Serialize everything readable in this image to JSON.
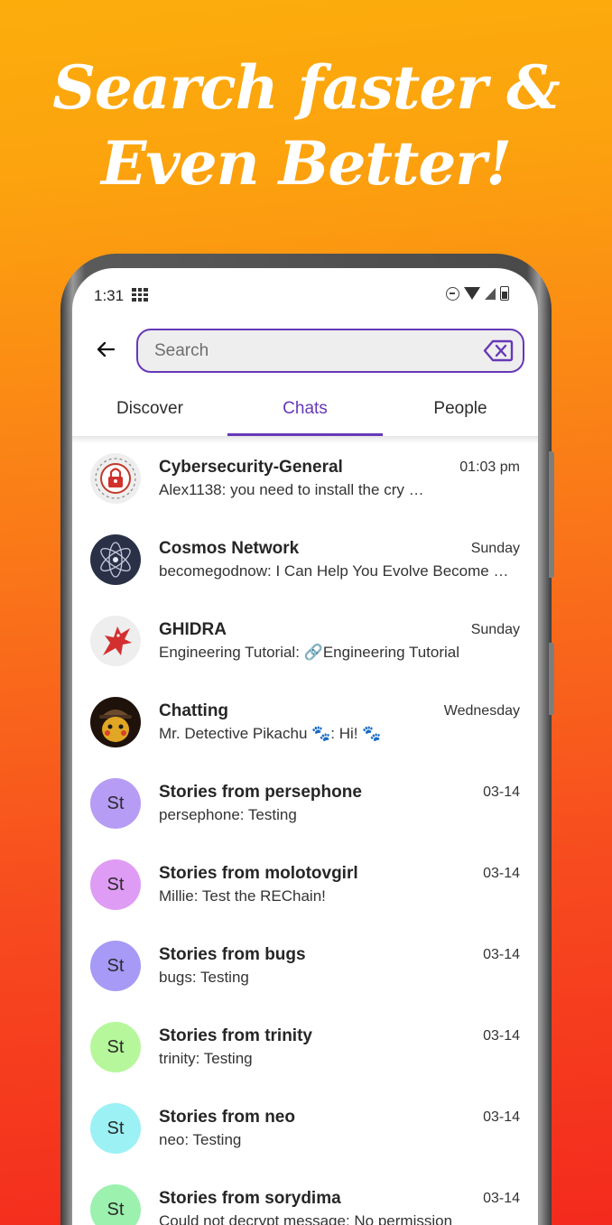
{
  "headline": {
    "line1": "Search faster &",
    "line2": "Even Better!"
  },
  "status_bar": {
    "time": "1:31",
    "icons": [
      "grid-icon",
      "dnd-icon",
      "wifi-icon",
      "signal-icon",
      "battery-icon"
    ]
  },
  "search": {
    "value": "",
    "placeholder": "Search"
  },
  "tabs": [
    {
      "label": "Discover",
      "active": false
    },
    {
      "label": "Chats",
      "active": true
    },
    {
      "label": "People",
      "active": false
    }
  ],
  "colors": {
    "accent": "#6638b8",
    "search_bg": "#eeeeee"
  },
  "chats": [
    {
      "name": "Cybersecurity-General",
      "time": "01:03 pm",
      "preview": "Alex1138: you need to install the cry …",
      "avatar": {
        "type": "image",
        "icon": "padlock-circuit-icon"
      }
    },
    {
      "name": "Cosmos Network",
      "time": "Sunday",
      "preview": "becomegodnow: I Can Help You Evolve Become …",
      "avatar": {
        "type": "image",
        "icon": "atom-icon"
      }
    },
    {
      "name": "GHIDRA",
      "time": "Sunday",
      "preview": "Engineering Tutorial: 🔗Engineering Tutorial",
      "avatar": {
        "type": "image",
        "icon": "dragon-icon"
      }
    },
    {
      "name": "Chatting",
      "time": "Wednesday",
      "preview": "Mr. Detective Pikachu 🐾: Hi! 🐾",
      "avatar": {
        "type": "image",
        "icon": "detective-pikachu-icon"
      }
    },
    {
      "name": "Stories from persephone",
      "time": "03-14",
      "preview": "persephone: Testing",
      "avatar": {
        "type": "initials",
        "initials": "St",
        "color": "#b69cf4"
      }
    },
    {
      "name": "Stories from molotovgirl",
      "time": "03-14",
      "preview": "Millie: Test the REChain!",
      "avatar": {
        "type": "initials",
        "initials": "St",
        "color": "#df9cf4"
      }
    },
    {
      "name": "Stories from bugs",
      "time": "03-14",
      "preview": "bugs: Testing",
      "avatar": {
        "type": "initials",
        "initials": "St",
        "color": "#a69af6"
      }
    },
    {
      "name": "Stories from trinity",
      "time": "03-14",
      "preview": "trinity: Testing",
      "avatar": {
        "type": "initials",
        "initials": "St",
        "color": "#b6f79c"
      }
    },
    {
      "name": "Stories from neo",
      "time": "03-14",
      "preview": "neo: Testing",
      "avatar": {
        "type": "initials",
        "initials": "St",
        "color": "#9cf1f4"
      }
    },
    {
      "name": "Stories from sorydima",
      "time": "03-14",
      "preview": "Could not decrypt message: No permission",
      "avatar": {
        "type": "initials",
        "initials": "St",
        "color": "#9cf1ae"
      }
    }
  ]
}
